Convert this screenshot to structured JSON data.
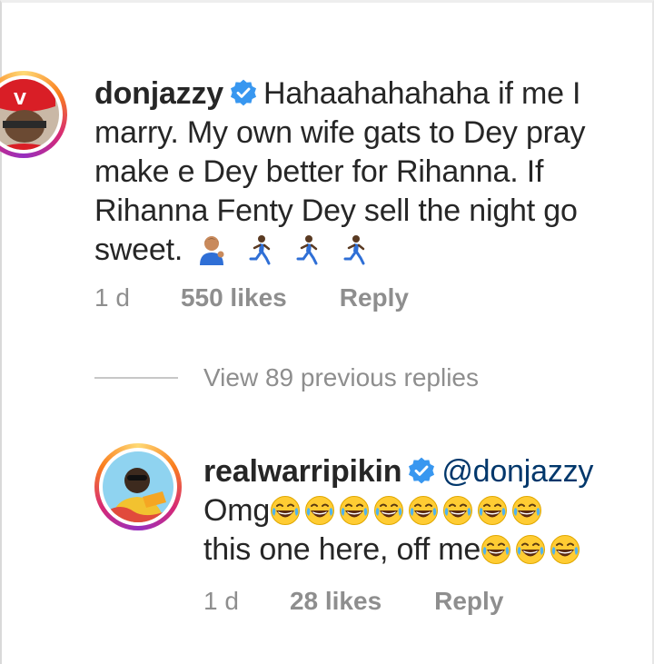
{
  "comment1": {
    "username": "donjazzy",
    "line1": "Hahaahahahaha if me I",
    "line2": "marry. My own wife gats to Dey pray",
    "line3": "make e Dey better for Rihanna. If",
    "line4": "Rihanna Fenty Dey sell the night go",
    "line5": "sweet.",
    "emojis": [
      "man-tipping-hand-icon",
      "man-running-icon",
      "man-running-icon",
      "man-running-icon"
    ],
    "time": "1 d",
    "likes": "550 likes",
    "reply": "Reply"
  },
  "view_replies": {
    "label": "View 89 previous replies"
  },
  "comment2": {
    "username": "realwarripikin",
    "mention": "@donjazzy",
    "line2": "Omg",
    "line3": "this one here, off me",
    "emojis_line2": 8,
    "emojis_line3": 3,
    "emoji_name": "face-with-tears-of-joy-icon",
    "time": "1 d",
    "likes": "28 likes",
    "reply": "Reply"
  },
  "colors": {
    "verified": "#3897f0",
    "text": "#262626",
    "muted": "#8e8e8e",
    "mention": "#00376b"
  }
}
